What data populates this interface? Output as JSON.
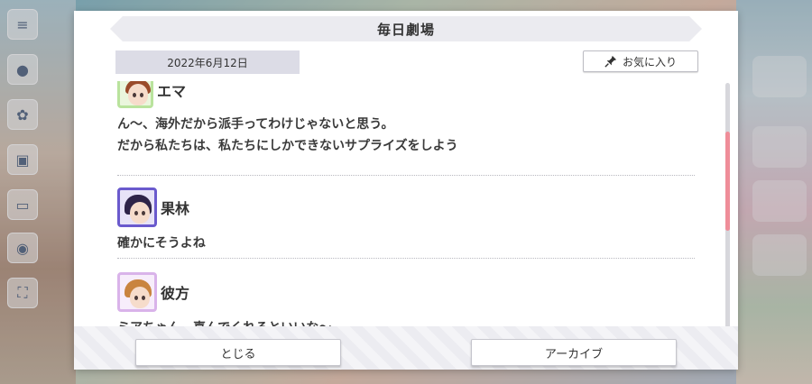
{
  "dialog": {
    "title": "毎日劇場",
    "date": "2022年6月12日",
    "favorite_label": "お気に入り",
    "entries": [
      {
        "speaker": "エマ",
        "lines": [
          "ん〜、海外だから派手ってわけじゃないと思う。",
          "だから私たちは、私たちにしかできないサプライズをしよう"
        ]
      },
      {
        "speaker": "果林",
        "lines": [
          "確かにそうよね"
        ]
      },
      {
        "speaker": "彼方",
        "lines": [
          "ミアちゃん、喜んでくれるといいな〜"
        ]
      }
    ],
    "close_label": "とじる",
    "archive_label": "アーカイブ"
  },
  "colors": {
    "accent_scroll": "#ef8d99",
    "avatar_emma_frame": "#b9e39d",
    "avatar_karin_frame": "#6a5acd",
    "avatar_kanata_frame": "#d9b3ea"
  }
}
